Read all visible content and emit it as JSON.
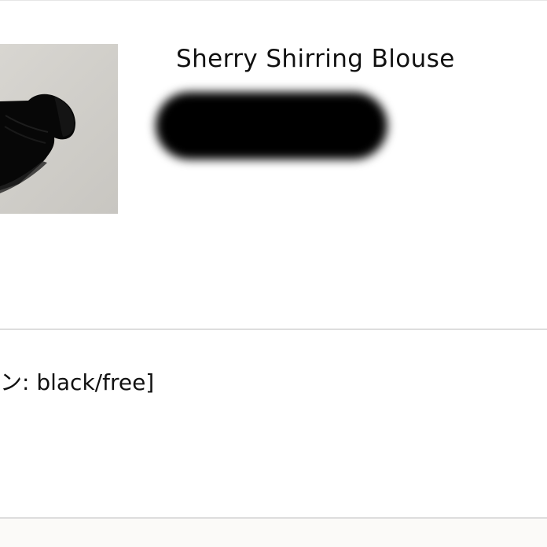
{
  "product": {
    "title": "Sherry Shirring Blouse"
  },
  "option": {
    "text": "ン: black/free]"
  },
  "colors": {
    "background": "#ffffff",
    "divider": "#dddddd",
    "image_background": "#d1cfca",
    "redaction": "#000000"
  },
  "icons": {
    "product_image": "black-blouse-product-photo"
  }
}
